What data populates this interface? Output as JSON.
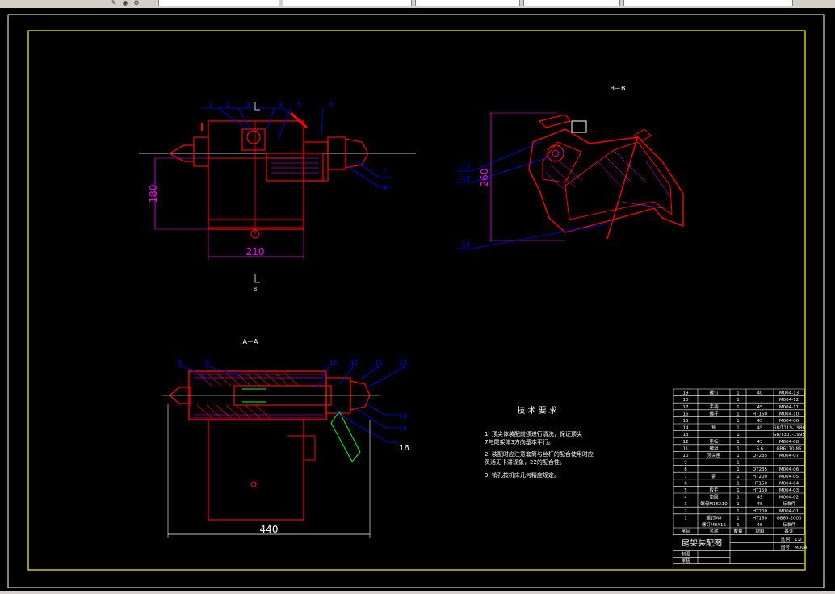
{
  "toolbar": {
    "fields": [
      "",
      "",
      "",
      "",
      "",
      ""
    ]
  },
  "drawing": {
    "section_bb": "B－B",
    "section_aa": "A－A",
    "mark_b": "B",
    "top_view": {
      "dim_height": "180",
      "dim_width": "210",
      "balloons": [
        "1",
        "2",
        "3",
        "4",
        "5",
        "6",
        "7",
        "8"
      ]
    },
    "side_view": {
      "dim_height": "260",
      "balloons": [
        "17",
        "18",
        "19"
      ]
    },
    "section_view": {
      "dim_length": "440",
      "balloons": [
        "8",
        "9",
        "10",
        "11",
        "12",
        "13",
        "14",
        "15",
        "16"
      ]
    },
    "tech_requirements": {
      "title": "技 术 要 求",
      "items": [
        "1. 顶尖体装配前须进行清洗，保证顶尖",
        "7与尾架体3方向基本平行。",
        "2. 装配时应注意套筒与丝杆的配合使用时应",
        "灵活无卡滞现象，22的配合性。",
        "3. 销孔按机床几何精度规定。"
      ]
    },
    "bom": {
      "rows": [
        [
          "19",
          "螺钉",
          "1",
          "40",
          "M004-13"
        ],
        [
          "18",
          "",
          "1",
          "",
          "M004-12"
        ],
        [
          "17",
          "手柄",
          "1",
          "45",
          "M004-11"
        ],
        [
          "16",
          "螺杆",
          "1",
          "HT150",
          "M004-10"
        ],
        [
          "15",
          "",
          "1",
          "45",
          "M004-06"
        ],
        [
          "14",
          "销",
          "1",
          "45",
          "GB/T119-1986"
        ],
        [
          "13",
          "",
          "1",
          "",
          "GB/T301-1995"
        ],
        [
          "12",
          "垫板",
          "1",
          "45",
          "M004-08"
        ],
        [
          "11",
          "螺母",
          "1",
          "5.6",
          "GB6170-86"
        ],
        [
          "10",
          "顶尖座",
          "1",
          "QT235",
          "M004-07"
        ],
        [
          "9",
          "",
          "1",
          "",
          ""
        ],
        [
          "8",
          "",
          "1",
          "QT235",
          "M004-06"
        ],
        [
          "7",
          "套",
          "1",
          "HT200",
          "M004-05"
        ],
        [
          "6",
          "",
          "1",
          "HT150",
          "M004-04"
        ],
        [
          "5",
          "扳手",
          "1",
          "HT150",
          "M004-03"
        ],
        [
          "4",
          "垫圈",
          "1",
          "45",
          "M004-02"
        ],
        [
          "3",
          "螺母M16X10",
          "1",
          "45",
          "标准件"
        ],
        [
          "2",
          "",
          "1",
          "HT200",
          "M004-01"
        ],
        [
          "1",
          "螺钉M8",
          "1",
          "HT150",
          "GB65-2000"
        ],
        [
          "",
          "螺钉M8X16",
          "1",
          "45",
          "标准件"
        ]
      ],
      "header": [
        "序号",
        "名称",
        "数量",
        "材料",
        "备注"
      ],
      "title": "尾架装配图",
      "scale_label": "比例",
      "scale": "1:2",
      "drawing_no_label": "图号",
      "drawing_no": "M004",
      "drawn_label": "制图",
      "checked_label": "审核"
    },
    "colors": {
      "frame": "#ffff00",
      "red": "#ff0000",
      "blue": "#0000ff",
      "magenta": "#ff00ff",
      "white": "#ffffff",
      "green": "#00ff00"
    }
  }
}
